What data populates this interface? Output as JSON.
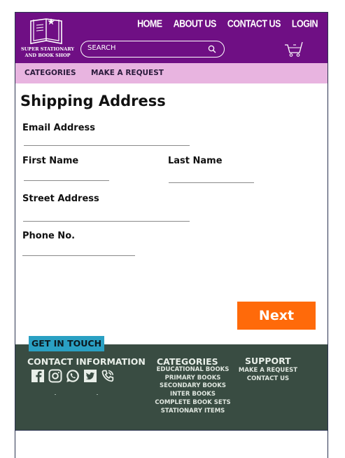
{
  "header": {
    "brand_line1": "SUPER STATIONARY",
    "brand_line2": "AND BOOK SHOP",
    "nav": [
      "HOME",
      "ABOUT US",
      "CONTACT US",
      "LOGIN"
    ],
    "search_placeholder": "SEARCH"
  },
  "catbar": {
    "categories": "CATEGORIES",
    "request": "MAKE A REQUEST"
  },
  "form": {
    "title": "Shipping Address",
    "email_label": "Email Address",
    "first_name_label": "First Name",
    "last_name_label": "Last Name",
    "street_label": "Street Address",
    "phone_label": "Phone No.",
    "next_label": "Next"
  },
  "footer": {
    "get_in_touch": "GET IN TOUCH",
    "contact_heading": "CONTACT INFORMATION",
    "categories_heading": "CATEGORIES",
    "categories": [
      "EDUCATIONAL BOOKS",
      "PRIMARY BOOKS",
      "SECONDARY BOOKS",
      "INTER BOOKS",
      "COMPLETE BOOK SETS",
      "STATIONARY ITEMS"
    ],
    "support_heading": "SUPPORT",
    "support": [
      "MAKE A REQUEST",
      "CONTACT US"
    ],
    "social_icons": [
      "facebook-icon",
      "instagram-icon",
      "whatsapp-icon",
      "twitter-icon",
      "phone-icon"
    ]
  },
  "colors": {
    "header": "#6f0f84",
    "catbar": "#e8b4e0",
    "next_button": "#ff6a0a",
    "footer": "#394c42",
    "get_in_touch": "#2aa0c3"
  }
}
